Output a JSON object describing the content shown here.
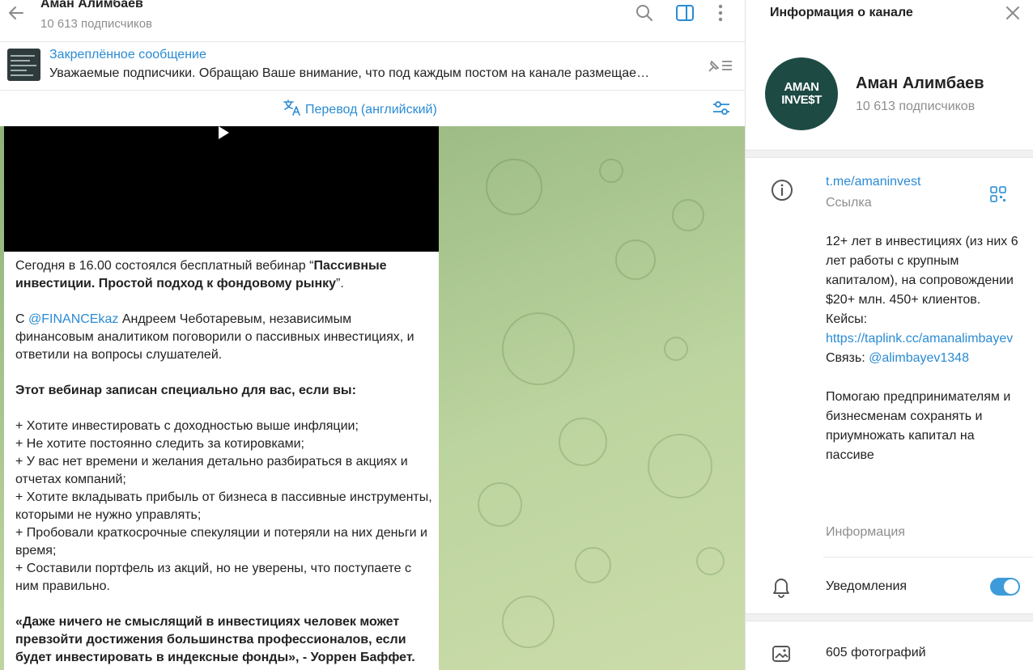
{
  "header": {
    "title": "Аман Алимбаев",
    "subscribers": "10 613 подписчиков"
  },
  "pinned": {
    "title": "Закреплённое сообщение",
    "text": "Уважаемые подписчики.   Обращаю Ваше внимание, что под каждым постом на канале размещае…"
  },
  "translate": {
    "label": "Перевод (английский)"
  },
  "post": {
    "p1_a": "Сегодня в 16.00 состоялся бесплатный вебинар “",
    "p1_bold": "Пассивные инвестиции. Простой подход к фондовому рынку",
    "p1_b": "”.",
    "p2_prefix": "С ",
    "p2_mention": "@FINANCEkaz",
    "p2_rest": " Андреем Чеботаревым, независимым финансовым аналитиком поговорили о пассивных инвестициях, и ответили на вопросы слушателей.",
    "heading": "Этот вебинар записан специально для вас, если вы:",
    "bullets": [
      "+ Хотите инвестировать с доходностью выше инфляции;",
      "+ Не хотите постоянно следить за котировками;",
      "+ У вас нет времени и желания детально разбираться в акциях и отчетах компаний;",
      "+ Хотите вкладывать прибыль от бизнеса в пассивные инструменты, которыми не нужно управлять;",
      "+ Пробовали краткосрочные спекуляции и потеряли на них деньги и время;",
      "+ Составили портфель из акций, но не уверены, что поступаете с ним правильно."
    ],
    "quote": "«Даже ничего не смыслящий в инвестициях человек может превзойти достижения большинства профессионалов, если будет инвестировать в индексные фонды», - Уоррен Баффет."
  },
  "panel": {
    "title": "Информация о канале",
    "avatar_line1": "AMAN",
    "avatar_line2": "INVE$T",
    "name": "Аман Алимбаев",
    "subscribers": "10 613 подписчиков",
    "link": "t.me/amaninvest",
    "link_caption": "Ссылка",
    "desc_line1": "12+ лет в инвестициях (из них 6 лет работы с крупным капиталом), на сопровождении $20+ млн. 450+ клиентов.",
    "desc_cases_label": "Кейсы:",
    "desc_cases_link": "https://taplink.cc/amanalimbayev",
    "desc_contact_label": "Связь: ",
    "desc_contact_link": "@alimbayev1348",
    "desc_line3": "Помогаю предпринимателям и бизнесменам сохранять и приумножать капитал на пассиве",
    "desc_caption": "Информация",
    "notifications_label": "Уведомления",
    "notifications_on": true,
    "photos_label": "605 фотографий"
  },
  "colors": {
    "accent": "#2a8bd4",
    "toggle": "#3d9bd9",
    "avatar_bg": "#1e4a44",
    "muted_text": "#8e8e8e"
  },
  "icons": {
    "back": "arrow-left-icon",
    "search": "search-icon",
    "sidebar": "sidebar-toggle-icon",
    "more": "more-vertical-icon",
    "pin_list": "pin-list-icon",
    "translate": "translate-icon",
    "settings": "sliders-icon",
    "play": "play-icon",
    "close": "close-icon",
    "info": "info-icon",
    "qr": "qr-code-icon",
    "bell": "bell-icon",
    "photos": "photos-icon"
  }
}
